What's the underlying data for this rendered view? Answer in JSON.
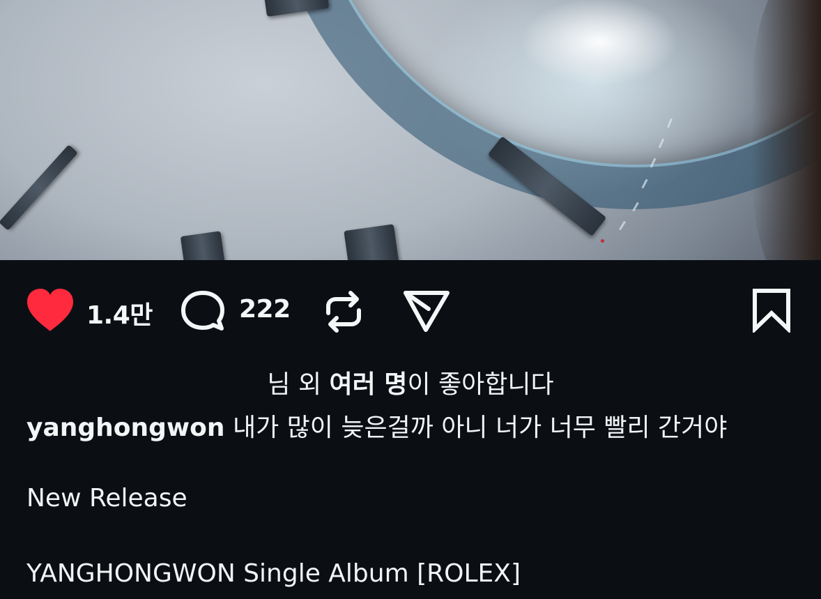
{
  "post": {
    "image_alt": "Rolex watch dial close-up"
  },
  "actions": {
    "like_count": "1.4만",
    "comment_count": "222",
    "like_color": "#ff2a3d"
  },
  "icons": {
    "like": "heart-icon",
    "comment": "comment-icon",
    "repost": "repost-icon",
    "share": "send-icon",
    "save": "bookmark-icon"
  },
  "likes": {
    "prefix": "님 외 ",
    "bold": "여러 명",
    "suffix": "이 좋아합니다"
  },
  "caption": {
    "username": "yanghongwon",
    "text": " 내가 많이 늦은걸까 아니 너가 너무 빨리 간거야",
    "line2": "New Release",
    "line3": "YANGHONGWON Single Album [ROLEX]"
  }
}
